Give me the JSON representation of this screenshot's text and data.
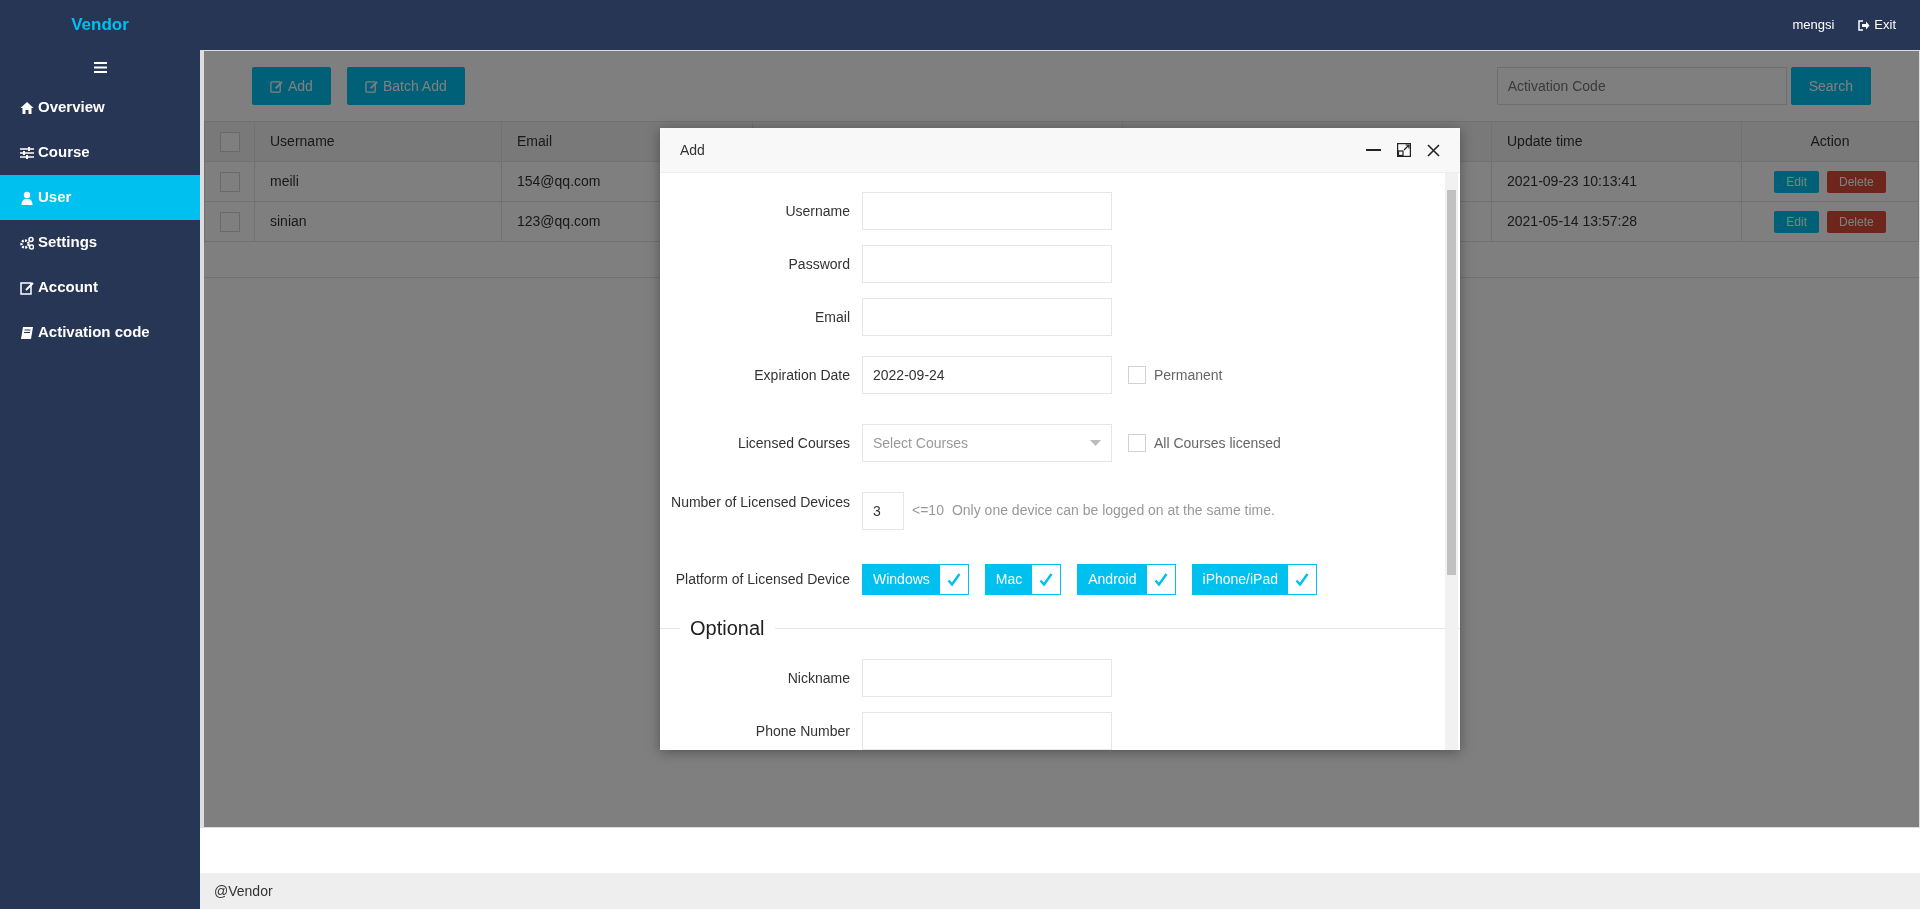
{
  "brand": "Vendor",
  "user_menu": {
    "username": "mengsi",
    "exit": "Exit"
  },
  "sidebar": {
    "items": [
      {
        "label": "Overview",
        "selected": false
      },
      {
        "label": "Course",
        "selected": false
      },
      {
        "label": "User",
        "selected": true
      },
      {
        "label": "Settings",
        "selected": false
      },
      {
        "label": "Account",
        "selected": false
      },
      {
        "label": "Activation code",
        "selected": false
      }
    ]
  },
  "toolbar": {
    "buttons": [
      "Add",
      "Batch Add"
    ],
    "search": {
      "placeholder": "Activation Code",
      "button": "Search"
    }
  },
  "table": {
    "select_all_checked": false,
    "columns": [
      "Username",
      "Email",
      "Update time",
      "Action"
    ],
    "rows": [
      {
        "checked": false,
        "username": "meili",
        "email": "154@qq.com",
        "update_time": "2021-09-23 10:13:41",
        "actions": [
          "Edit",
          "Delete"
        ]
      },
      {
        "checked": false,
        "username": "sinian",
        "email": "123@qq.com",
        "update_time": "2021-05-14 13:57:28",
        "actions": [
          "Edit",
          "Delete"
        ]
      }
    ]
  },
  "dialog": {
    "title": "Add",
    "fields": [
      {
        "kind": "text",
        "label": "Username"
      },
      {
        "kind": "text",
        "label": "Password"
      },
      {
        "kind": "text",
        "label": "Email"
      },
      {
        "kind": "text",
        "label": "Expiration Date",
        "value": "2022-09-24",
        "checkbox": {
          "label": "Permanent",
          "checked": false
        }
      },
      {
        "kind": "select",
        "label": "Licensed Courses",
        "placeholder": "Select Courses",
        "checkbox": {
          "label": "All Courses licensed",
          "checked": false
        }
      },
      {
        "kind": "number",
        "label": "Number of Licensed Devices",
        "value": "3",
        "hint": "<=10",
        "note": "Only one device can be logged on at the same time."
      },
      {
        "kind": "toggles",
        "label": "Platform of Licensed Device",
        "options": [
          {
            "label": "Windows",
            "checked": true
          },
          {
            "label": "Mac",
            "checked": true
          },
          {
            "label": "Android",
            "checked": true
          },
          {
            "label": "iPhone/iPad",
            "checked": true
          }
        ]
      },
      {
        "kind": "section",
        "label": "Optional"
      },
      {
        "kind": "text",
        "label": "Nickname"
      },
      {
        "kind": "text",
        "label": "Phone Number"
      }
    ]
  },
  "footer": "@Vendor"
}
